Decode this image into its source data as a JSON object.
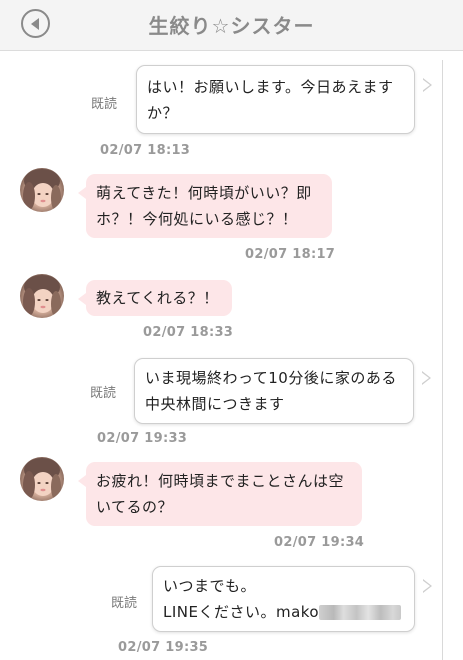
{
  "header": {
    "title": "生絞り☆シスター"
  },
  "messages": [
    {
      "direction": "out",
      "read_label": "既読",
      "lines": [
        "はい！お願いします。今日あえます",
        "か？"
      ],
      "time": "02/07 18:13"
    },
    {
      "direction": "in",
      "lines": [
        "萌えてきた！何時頃がいい？即",
        "ホ？！今何処にいる感じ？！"
      ],
      "time": "02/07 18:17"
    },
    {
      "direction": "in",
      "lines": [
        "教えてくれる？！"
      ],
      "time": "02/07 18:33"
    },
    {
      "direction": "out",
      "read_label": "既読",
      "lines": [
        "いま現場終わって10分後に家のある",
        "中央林間につきます"
      ],
      "time": "02/07 19:33"
    },
    {
      "direction": "in",
      "lines": [
        "お疲れ！何時頃までまことさんは空",
        "いてるの？"
      ],
      "time": "02/07 19:34"
    },
    {
      "direction": "out",
      "read_label": "既読",
      "lines": [
        "いつまでも。",
        "LINEください。mako"
      ],
      "time": "02/07 19:35"
    }
  ],
  "icons": {
    "back": "chevron-left-circle-icon",
    "avatar": "contact-avatar"
  },
  "colors": {
    "incoming_bubble": "#fde6e8",
    "outgoing_bubble": "#ffffff",
    "header_bg": "#f4f4f4",
    "timestamp": "#9a9a9a"
  }
}
